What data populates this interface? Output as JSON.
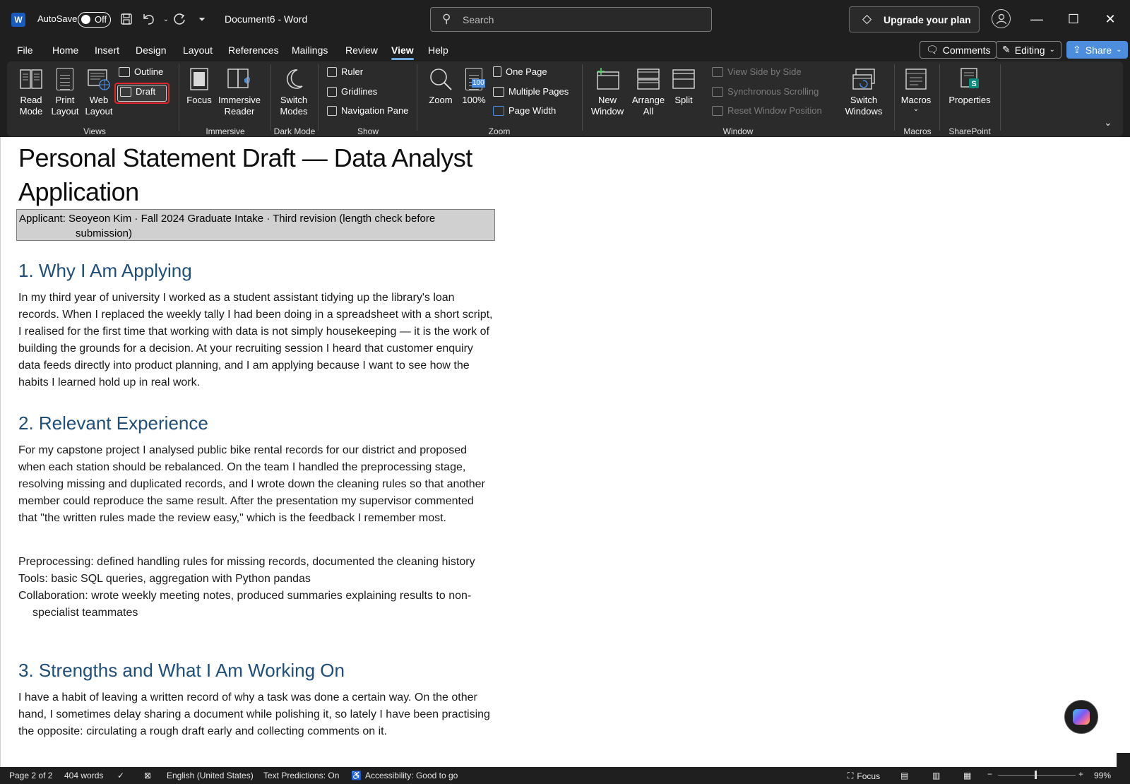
{
  "titlebar": {
    "app_logo": "W",
    "autosave_label": "AutoSave",
    "autosave_state": "Off",
    "doc_title": "Document6  -  Word",
    "search_placeholder": "Search",
    "upgrade_label": "Upgrade your plan",
    "icons": [
      "save-icon",
      "undo-icon",
      "redo-icon",
      "customize-qat-icon",
      "diamond-icon",
      "avatar-icon",
      "minimize-icon",
      "maximize-icon",
      "close-icon"
    ]
  },
  "menu": {
    "tabs": [
      "File",
      "Home",
      "Insert",
      "Design",
      "Layout",
      "References",
      "Mailings",
      "Review",
      "View",
      "Help"
    ],
    "active_tab": "View",
    "comments_label": "Comments",
    "editing_label": "Editing",
    "share_label": "Share"
  },
  "ribbon": {
    "views": {
      "read_mode": "Read\nMode",
      "print_layout": "Print\nLayout",
      "web_layout": "Web\nLayout",
      "outline": "Outline",
      "draft": "Draft",
      "group": "Views"
    },
    "immersive": {
      "focus": "Focus",
      "immersive_reader": "Immersive\nReader",
      "group": "Immersive"
    },
    "dark_mode": {
      "switch_modes": "Switch\nModes",
      "group": "Dark Mode"
    },
    "show": {
      "ruler": "Ruler",
      "gridlines": "Gridlines",
      "navigation_pane": "Navigation Pane",
      "group": "Show"
    },
    "zoom": {
      "zoom": "Zoom",
      "hundred": "100%",
      "hundred_badge": "100",
      "one_page": "One Page",
      "multiple_pages": "Multiple Pages",
      "page_width": "Page Width",
      "group": "Zoom"
    },
    "window": {
      "new_window": "New\nWindow",
      "arrange_all": "Arrange\nAll",
      "split": "Split",
      "view_side_by_side": "View Side by Side",
      "synchronous_scrolling": "Synchronous Scrolling",
      "reset_window_position": "Reset Window Position",
      "switch_windows": "Switch\nWindows",
      "group": "Window"
    },
    "macros": {
      "macros": "Macros",
      "group": "Macros"
    },
    "sharepoint": {
      "properties": "Properties",
      "group": "SharePoint"
    }
  },
  "document": {
    "title": "Personal Statement Draft — Data Analyst Application",
    "applicant_line1": "Applicant: Seoyeon Kim · Fall 2024 Graduate Intake · Third revision (length check before",
    "applicant_line2": "submission)",
    "sections": [
      {
        "heading": "1. Why I Am Applying",
        "body": "In my third year of university I worked as a student assistant tidying up the library's loan records. When I replaced the weekly tally I had been doing in a spreadsheet with a short script, I realised for the first time that working with data is not simply housekeeping — it is the work of building the grounds for a decision. At your recruiting session I heard that customer enquiry data feeds directly into product planning, and I am applying because I want to see how the habits I learned hold up in real work."
      },
      {
        "heading": "2. Relevant Experience",
        "body": "For my capstone project I analysed public bike rental records for our district and proposed when each station should be rebalanced. On the team I handled the preprocessing stage, resolving missing and duplicated records, and I wrote down the cleaning rules so that another member could reproduce the same result. After the presentation my supervisor commented that \"the written rules made the review easy,\" which is the feedback I remember most.",
        "bullets": [
          "Preprocessing: defined handling rules for missing records, documented the cleaning history",
          "Tools: basic SQL queries, aggregation with Python pandas",
          "Collaboration: wrote weekly meeting notes, produced summaries explaining results to non-specialist teammates"
        ]
      },
      {
        "heading": "3. Strengths and What I Am Working On",
        "body": "I have a habit of leaving a written record of why a task was done a certain way. On the other hand, I sometimes delay sharing a document while polishing it, so lately I have been practising the opposite: circulating a rough draft early and collecting comments on it."
      }
    ]
  },
  "statusbar": {
    "page": "Page 2 of 2",
    "words": "404 words",
    "language": "English (United States)",
    "predictions": "Text Predictions: On",
    "accessibility": "Accessibility: Good to go",
    "focus": "Focus",
    "zoom_pct": "99%",
    "zoom_value": 0.99
  },
  "colors": {
    "accent": "#4c8dde",
    "heading": "#1e4e79",
    "highlight_border": "#e0242c"
  }
}
